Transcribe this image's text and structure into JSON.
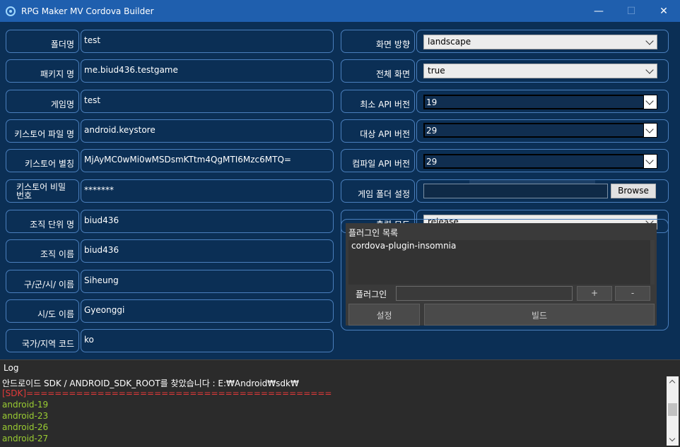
{
  "window": {
    "title": "RPG Maker MV Cordova Builder",
    "minimize": "—",
    "maximize": "☐",
    "close": "✕"
  },
  "left_fields": [
    {
      "label": "폴더명",
      "value": "test"
    },
    {
      "label": "패키지 명",
      "value": "me.biud436.testgame"
    },
    {
      "label": "게임명",
      "value": "test"
    },
    {
      "label": "키스토어 파일 명",
      "value": "android.keystore"
    },
    {
      "label": "키스토어 별칭",
      "value": "MjAyMC0wMi0wMSDsmKTtm4QgMTI6Mzc6MTQ="
    },
    {
      "label": "키스토어 비밀번호",
      "value": "*******"
    },
    {
      "label": "조직 단위 명",
      "value": "biud436"
    },
    {
      "label": "조직 이름",
      "value": "biud436"
    },
    {
      "label": "구/군/시/ 이름",
      "value": "Siheung"
    },
    {
      "label": "시/도 이름",
      "value": "Gyeonggi"
    },
    {
      "label": "국가/지역 코드",
      "value": "ko"
    }
  ],
  "right_fields": {
    "orientation": {
      "label": "화면 방향",
      "value": "landscape"
    },
    "fullscreen": {
      "label": "전체 화면",
      "value": "true"
    },
    "min_api": {
      "label": "최소 API 버전",
      "value": "19"
    },
    "target_api": {
      "label": "대상 API 버전",
      "value": "29"
    },
    "compile_api": {
      "label": "컴파일 API 버전",
      "value": "29"
    },
    "game_folder": {
      "label": "게임 폴더 설정",
      "value": "",
      "browse": "Browse"
    },
    "output_mode": {
      "label": "출력 모드",
      "value": "release"
    }
  },
  "plugins": {
    "title": "플러그인 목록",
    "items": [
      "cordova-plugin-insomnia"
    ],
    "input_label": "플러그인",
    "add": "+",
    "remove": "-",
    "settings": "설정",
    "build": "빌드"
  },
  "log": {
    "title": "Log",
    "lines": [
      {
        "text": "안드로이드 SDK / ANDROID_SDK_ROOT를 찾았습니다 : E:₩Android₩sdk₩",
        "color": "white"
      },
      {
        "text": "[SDK]===========================================",
        "color": "red"
      },
      {
        "text": "android-19",
        "color": "green"
      },
      {
        "text": "android-23",
        "color": "green"
      },
      {
        "text": "android-26",
        "color": "green"
      },
      {
        "text": "android-27",
        "color": "green"
      }
    ]
  },
  "colors": {
    "background": "#0b2f55",
    "titlebar": "#1f5fae",
    "border": "#4a7fbd",
    "log_red": "#e23a3a",
    "log_green": "#9acd32"
  }
}
